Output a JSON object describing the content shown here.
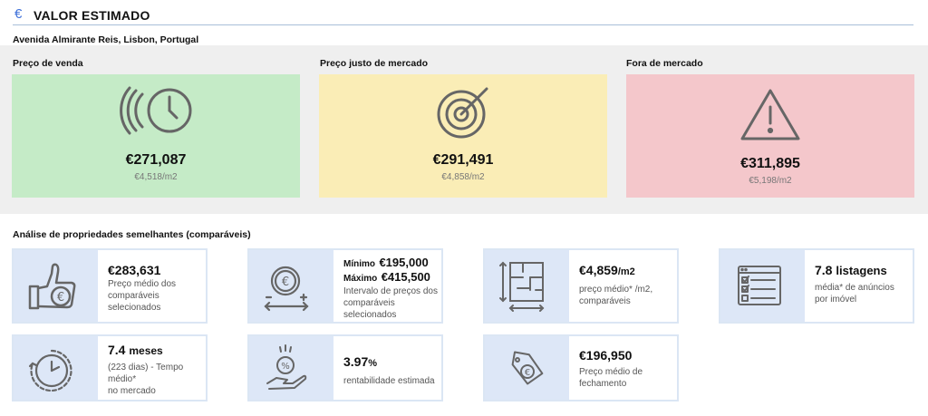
{
  "header": {
    "icon": "euro-icon",
    "euro_glyph": "€",
    "title": "VALOR ESTIMADO"
  },
  "address": "Avenida Almirante Reis, Lisbon, Portugal",
  "valuation": [
    {
      "label": "Preço de venda",
      "price": "€271,087",
      "per_m2": "€4,518/m2",
      "color": "#c5ebc7",
      "icon": "clock-speed-icon"
    },
    {
      "label": "Preço justo de mercado",
      "price": "€291,491",
      "per_m2": "€4,858/m2",
      "color": "#faedb6",
      "icon": "target-icon"
    },
    {
      "label": "Fora de mercado",
      "price": "€311,895",
      "per_m2": "€5,198/m2",
      "color": "#f4c7cb",
      "icon": "warning-icon"
    }
  ],
  "comparables": {
    "title": "Análise de propriedades semelhantes (comparáveis)",
    "cards": [
      {
        "icon": "thumbs-up-icon",
        "big": "€283,631",
        "desc": [
          "Preço médio dos",
          "comparáveis",
          "selecionados"
        ]
      },
      {
        "icon": "coin-range-icon",
        "min_label": "Mínimo",
        "min_value": "€195,000",
        "max_label": "Máximo",
        "max_value": "€415,500",
        "desc": [
          "Intervalo de preços dos",
          "comparáveis",
          "selecionados"
        ]
      },
      {
        "icon": "floor-plan-icon",
        "big": "€4,859",
        "big_unit": "/m2",
        "desc": [
          "preço médio* /m2,",
          "comparáveis"
        ]
      },
      {
        "icon": "listings-icon",
        "big": "7.8",
        "big_unit": "listagens",
        "desc": [
          "média* de anúncios",
          "por imóvel"
        ]
      },
      {
        "icon": "timer-icon",
        "big": "7.4",
        "big_unit": "meses",
        "desc": [
          "(223 dias) - Tempo",
          "médio*",
          "no mercado"
        ]
      },
      {
        "icon": "percent-hand-icon",
        "big": "3.97",
        "big_unit": "%",
        "desc": [
          "rentabilidade estimada"
        ]
      },
      {
        "icon": "price-tag-icon",
        "big": "€196,950",
        "desc": [
          "Preço médio de",
          "fechamento"
        ]
      }
    ]
  }
}
